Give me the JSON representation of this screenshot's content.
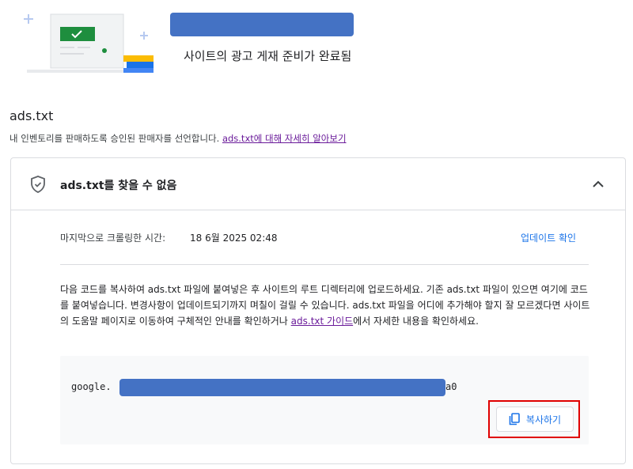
{
  "hero": {
    "title": "사이트의 광고 게재 준비가 완료됨"
  },
  "section": {
    "title": "ads.txt",
    "description": "내 인벤토리를 판매하도록 승인된 판매자를 선언합니다. ",
    "learn_more": "ads.txt에 대해 자세히 알아보기"
  },
  "card": {
    "status": "ads.txt를 찾을 수 없음",
    "crawl_label": "마지막으로 크롤링한 시간:",
    "crawl_value": "18 6월 2025 02:48",
    "check_update": "업데이트 확인",
    "instructions_before": "다음 코드를 복사하여 ads.txt 파일에 붙여넣은 후 사이트의 루트 디렉터리에 업로드하세요. 기존 ads.txt 파일이 있으면 여기에 코드를 붙여넣습니다. 변경사항이 업데이트되기까지 며칠이 걸릴 수 있습니다. ads.txt 파일을 어디에 추가해야 할지 잘 모르겠다면 사이트의 도움말 페이지로 이동하여 구체적인 안내를 확인하거나 ",
    "instructions_link": "ads.txt 가이드",
    "instructions_after": "에서 자세한 내용을 확인하세요.",
    "code_prefix": "google.",
    "code_suffix": "a0",
    "copy_label": "복사하기"
  },
  "colors": {
    "accent": "#1a73e8",
    "link_visited": "#6a1b9a",
    "highlight": "#e00000",
    "redaction": "#4472c4",
    "success": "#1e8e3e"
  },
  "icons": {
    "status": "shield-check-icon",
    "collapse": "chevron-up-icon",
    "copy": "copy-icon"
  }
}
